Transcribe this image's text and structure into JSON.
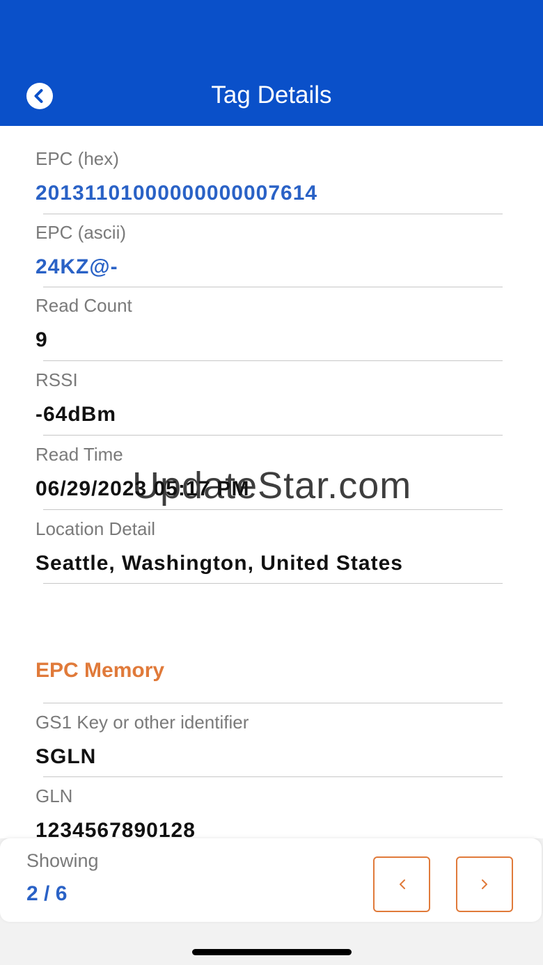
{
  "header": {
    "title": "Tag Details",
    "back_icon": "chevron-left-circle-icon"
  },
  "fields": [
    {
      "label": "EPC (hex)",
      "value": "20131101000000000007614",
      "accent": true
    },
    {
      "label": "EPC (ascii)",
      "value": "24KZ@-",
      "accent": true
    },
    {
      "label": "Read Count",
      "value": "9",
      "accent": false
    },
    {
      "label": "RSSI",
      "value": "-64dBm",
      "accent": false
    },
    {
      "label": "Read Time",
      "value": "06/29/2023 05:17 PM",
      "accent": false
    },
    {
      "label": "Location Detail",
      "value": "Seattle, Washington, United States",
      "accent": false
    }
  ],
  "epc_memory": {
    "title": "EPC Memory",
    "fields": [
      {
        "label": "GS1 Key or other identifier",
        "value": "SGLN"
      },
      {
        "label": "GLN",
        "value": "1234567890128"
      }
    ]
  },
  "watermark": "UpdateStar.com",
  "footer": {
    "showing_label": "Showing",
    "showing_value": "2 / 6",
    "prev_icon": "chevron-left-icon",
    "next_icon": "chevron-right-icon"
  },
  "colors": {
    "header": "#0a50c9",
    "accent_blue": "#2a62c6",
    "accent_orange": "#e07a3a"
  }
}
